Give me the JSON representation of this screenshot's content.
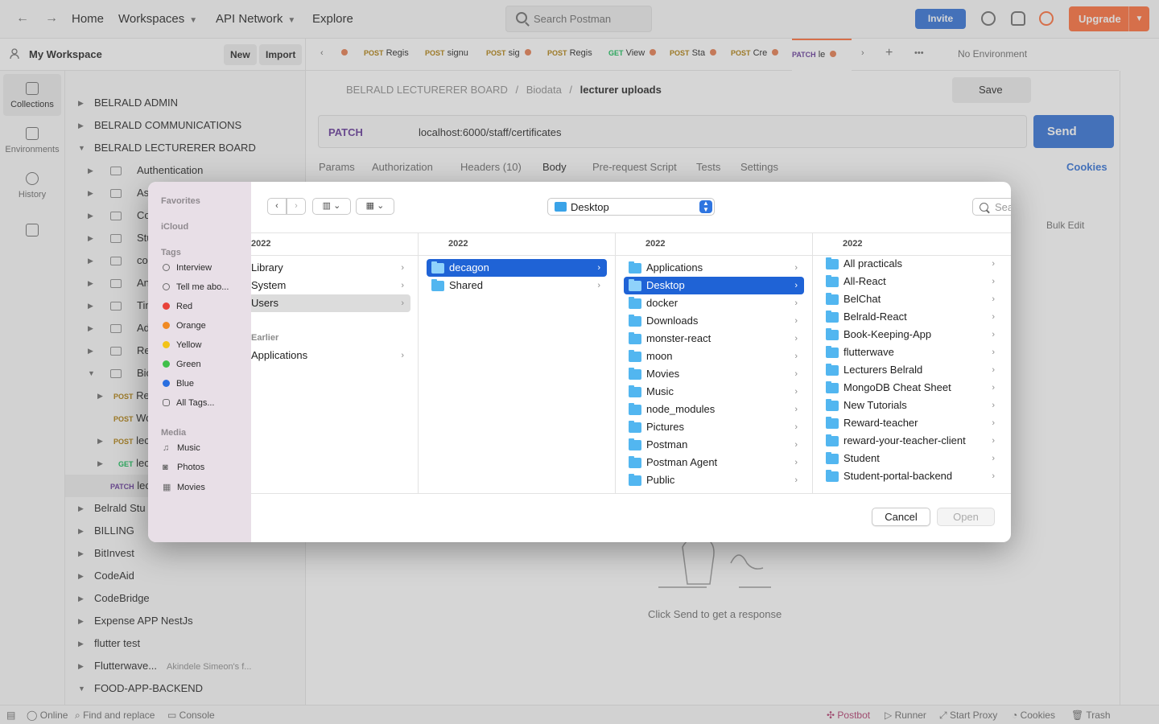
{
  "topbar": {
    "home": "Home",
    "workspaces": "Workspaces",
    "api_network": "API Network",
    "explore": "Explore",
    "search_placeholder": "Search Postman",
    "invite": "Invite",
    "upgrade": "Upgrade"
  },
  "workspace": {
    "title": "My Workspace",
    "new_label": "New",
    "import_label": "Import"
  },
  "rail": [
    {
      "label": "Collections"
    },
    {
      "label": "Environments"
    },
    {
      "label": "History"
    }
  ],
  "tree": [
    {
      "label": "BELRALD ADMIN"
    },
    {
      "label": "BELRALD COMMUNICATIONS"
    },
    {
      "label": "BELRALD LECTURERER BOARD"
    },
    {
      "label": "Authentication"
    },
    {
      "label": "Assig"
    },
    {
      "label": "Cour"
    },
    {
      "label": "Stud"
    },
    {
      "label": "comr"
    },
    {
      "label": "Answ"
    },
    {
      "label": "Time"
    },
    {
      "label": "Adm"
    },
    {
      "label": "Reco"
    },
    {
      "label": "Biod"
    },
    {
      "method": "POST",
      "label": "Re"
    },
    {
      "method": "POST",
      "label": "Wo"
    },
    {
      "method": "POST",
      "label": "lec"
    },
    {
      "method": "GET",
      "label": "lec"
    },
    {
      "method": "PATCH",
      "label": "lec"
    },
    {
      "label": "Belrald Stu"
    },
    {
      "label": "BILLING"
    },
    {
      "label": "BitInvest"
    },
    {
      "label": "CodeAid"
    },
    {
      "label": "CodeBridge"
    },
    {
      "label": "Expense APP NestJs"
    },
    {
      "label": "flutter test"
    },
    {
      "label": "Flutterwave...",
      "extra": "Akindele Simeon's f..."
    },
    {
      "label": "FOOD-APP-BACKEND"
    }
  ],
  "request_tabs": [
    {
      "method": "POST",
      "label": "Regis"
    },
    {
      "method": "POST",
      "label": "signu"
    },
    {
      "method": "POST",
      "label": "sig"
    },
    {
      "method": "POST",
      "label": "Regis"
    },
    {
      "method": "GET",
      "label": "View"
    },
    {
      "method": "POST",
      "label": "Sta"
    },
    {
      "method": "POST",
      "label": "Cre"
    },
    {
      "method": "PATCH",
      "label": "le"
    }
  ],
  "environment": "No Environment",
  "breadcrumb": {
    "collection": "BELRALD LECTURERER BOARD",
    "folder": "Biodata",
    "request": "lecturer uploads",
    "sep": "/"
  },
  "request": {
    "method": "PATCH",
    "url": "localhost:6000/staff/certificates",
    "save": "Save",
    "send": "Send",
    "tabs": [
      "Params",
      "Authorization",
      "Headers (10)",
      "Body",
      "Pre-request Script",
      "Tests",
      "Settings"
    ],
    "cookies": "Cookies",
    "bulk_edit": "Bulk Edit"
  },
  "response_hint": "Click Send to get a response",
  "statusbar": {
    "online": "Online",
    "find_replace": "Find and replace",
    "console": "Console",
    "postbot": "Postbot",
    "runner": "Runner",
    "start_proxy": "Start Proxy",
    "cookies": "Cookies",
    "trash": "Trash"
  },
  "dialog": {
    "sidebar": {
      "favorites": "Favorites",
      "icloud": "iCloud",
      "tags": "Tags",
      "tag_items": [
        {
          "label": "Interview",
          "color": ""
        },
        {
          "label": "Tell me abo...",
          "color": ""
        },
        {
          "label": "Red",
          "color": "#e8423a"
        },
        {
          "label": "Orange",
          "color": "#f08a24"
        },
        {
          "label": "Yellow",
          "color": "#f2c318"
        },
        {
          "label": "Green",
          "color": "#3fbf4a"
        },
        {
          "label": "Blue",
          "color": "#2a6fe0"
        },
        {
          "label": "All Tags...",
          "color": ""
        }
      ],
      "media": "Media",
      "media_items": [
        {
          "label": "Music",
          "icon": "music-icon"
        },
        {
          "label": "Photos",
          "icon": "camera-icon"
        },
        {
          "label": "Movies",
          "icon": "film-icon"
        }
      ]
    },
    "location": "Desktop",
    "search_placeholder": "Search",
    "columns": [
      {
        "header": "2022",
        "items": [
          "Library",
          "System",
          "Users"
        ],
        "earlier_label": "Earlier",
        "earlier_items": [
          "Applications"
        ]
      },
      {
        "header": "2022",
        "items": [
          "decagon",
          "Shared"
        ]
      },
      {
        "header": "2022",
        "items": [
          "Applications",
          "Desktop",
          "docker",
          "Downloads",
          "monster-react",
          "moon",
          "Movies",
          "Music",
          "node_modules",
          "Pictures",
          "Postman",
          "Postman Agent",
          "Public"
        ]
      },
      {
        "header": "2022",
        "items": [
          "All practicals",
          "All-React",
          "BelChat",
          "Belrald-React",
          "Book-Keeping-App",
          "flutterwave",
          "Lecturers Belrald",
          "MongoDB Cheat Sheet",
          "New Tutorials",
          "Reward-teacher",
          "reward-your-teacher-client",
          "Student",
          "Student-portal-backend"
        ]
      }
    ],
    "cancel": "Cancel",
    "open": "Open"
  }
}
